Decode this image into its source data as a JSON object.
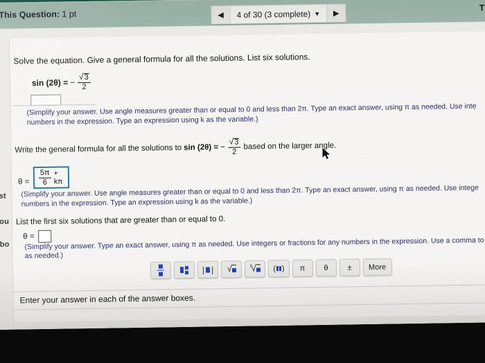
{
  "header": {
    "question_label_prefix": "This Question:",
    "points": "1 pt",
    "right_label": "Thi",
    "pager": {
      "prev_icon": "triangle-left-icon",
      "next_icon": "triangle-right-icon",
      "label": "4 of 30 (3 complete)",
      "caret": "▼"
    }
  },
  "sidebar_fragments": [
    {
      "text": "est"
    },
    {
      "text": "sou"
    },
    {
      "text": "ebo"
    }
  ],
  "main": {
    "question_text": "Solve the equation. Give a general formula for all the solutions. List six solutions.",
    "equation": {
      "lhs": "sin (2θ) =",
      "sign": "−",
      "numerator": "3",
      "radical": "√",
      "denominator": "2"
    },
    "instruction_1": {
      "line1": "(Simplify your answer. Use angle measures greater than or equal to 0 and less than 2π. Type an exact answer, using π as needed. Use inte",
      "line2": "numbers in the expression. Type an expression using k as the variable.)"
    },
    "part_b": {
      "text_before": "Write the general formula for all the solutions to",
      "lhs": "sin (2θ) =",
      "sign": "−",
      "numerator": "3",
      "radical": "√",
      "denominator": "2",
      "text_after": "based on the larger angle."
    },
    "answer_1": {
      "label": "θ =",
      "numerator": "5π",
      "denominator": "6",
      "suffix": "+ kπ",
      "border_color": "#1f7a8c"
    },
    "instruction_2": {
      "line1": "(Simplify your answer. Use angle measures greater than or equal to 0 and less than 2π. Type an exact answer, using π as needed. Use intege",
      "line2": "numbers in the expression. Type an expression using k as the variable.)"
    },
    "part_c": {
      "text": "List the first six solutions that are greater than or equal to 0."
    },
    "answer_2": {
      "label": "θ =",
      "value": ""
    },
    "instruction_3": {
      "line1": "(Simplify your answer. Type an exact answer, using π as needed. Use integers or fractions for any numbers in the expression. Use a comma to",
      "line2": "as needed.)"
    }
  },
  "palette": {
    "buttons": [
      {
        "name": "fraction",
        "label": ""
      },
      {
        "name": "mixed-number",
        "label": ""
      },
      {
        "name": "absolute-value",
        "label": ""
      },
      {
        "name": "square-root",
        "label": ""
      },
      {
        "name": "nth-root",
        "label": ""
      },
      {
        "name": "interval",
        "label": ""
      },
      {
        "name": "pi",
        "label": "π"
      },
      {
        "name": "theta",
        "label": "θ"
      },
      {
        "name": "plus-minus",
        "label": "±"
      },
      {
        "name": "more",
        "label": "More"
      }
    ]
  },
  "footer": {
    "status": "Enter your answer in each of the answer boxes."
  },
  "colors": {
    "app_band": "#0c4a38",
    "header_bar": "#9db6ac",
    "answer_border": "#1f7a8c",
    "instruction_text": "#2b2f63",
    "palette_blue": "#2741b0"
  }
}
